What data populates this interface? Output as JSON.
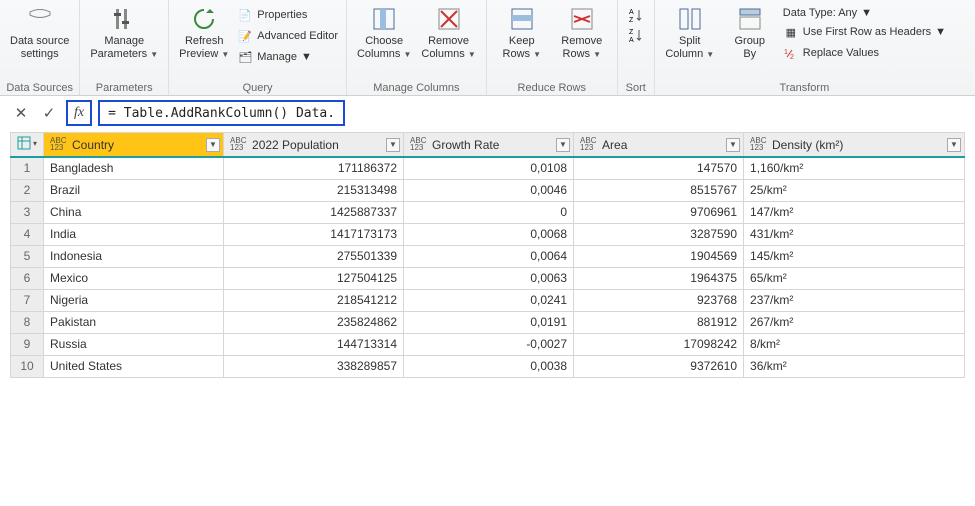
{
  "ribbon": {
    "dataSource": {
      "label": "Data source\nsettings",
      "group": "Data Sources"
    },
    "parameters": {
      "label": "Manage\nParameters",
      "group": "Parameters"
    },
    "query": {
      "refresh": "Refresh\nPreview",
      "properties": "Properties",
      "advanced": "Advanced Editor",
      "manage": "Manage",
      "group": "Query"
    },
    "manageColumns": {
      "choose": "Choose\nColumns",
      "remove": "Remove\nColumns",
      "group": "Manage Columns"
    },
    "reduceRows": {
      "keep": "Keep\nRows",
      "remove": "Remove\nRows",
      "group": "Reduce Rows"
    },
    "sort": {
      "group": "Sort"
    },
    "transform": {
      "split": "Split\nColumn",
      "groupBy": "Group\nBy",
      "dataType": "Data Type: Any",
      "firstRow": "Use First Row as Headers",
      "replace": "Replace Values",
      "group": "Transform"
    }
  },
  "formula": {
    "fx": "fx",
    "text": "= Table.AddRankColumn()  Data."
  },
  "columns": {
    "country": "Country",
    "population": "2022 Population",
    "growth": "Growth Rate",
    "area": "Area",
    "density": "Density (km²)",
    "abc": "ABC",
    "n123": "123"
  },
  "rows": [
    {
      "n": "1",
      "country": "Bangladesh",
      "pop": "171186372",
      "growth": "0,0108",
      "area": "147570",
      "density": "1,160/km²"
    },
    {
      "n": "2",
      "country": "Brazil",
      "pop": "215313498",
      "growth": "0,0046",
      "area": "8515767",
      "density": "25/km²"
    },
    {
      "n": "3",
      "country": "China",
      "pop": "1425887337",
      "growth": "0",
      "area": "9706961",
      "density": "147/km²"
    },
    {
      "n": "4",
      "country": "India",
      "pop": "1417173173",
      "growth": "0,0068",
      "area": "3287590",
      "density": "431/km²"
    },
    {
      "n": "5",
      "country": "Indonesia",
      "pop": "275501339",
      "growth": "0,0064",
      "area": "1904569",
      "density": "145/km²"
    },
    {
      "n": "6",
      "country": "Mexico",
      "pop": "127504125",
      "growth": "0,0063",
      "area": "1964375",
      "density": "65/km²"
    },
    {
      "n": "7",
      "country": "Nigeria",
      "pop": "218541212",
      "growth": "0,0241",
      "area": "923768",
      "density": "237/km²"
    },
    {
      "n": "8",
      "country": "Pakistan",
      "pop": "235824862",
      "growth": "0,0191",
      "area": "881912",
      "density": "267/km²"
    },
    {
      "n": "9",
      "country": "Russia",
      "pop": "144713314",
      "growth": "-0,0027",
      "area": "17098242",
      "density": "8/km²"
    },
    {
      "n": "10",
      "country": "United States",
      "pop": "338289857",
      "growth": "0,0038",
      "area": "9372610",
      "density": "36/km²"
    }
  ]
}
